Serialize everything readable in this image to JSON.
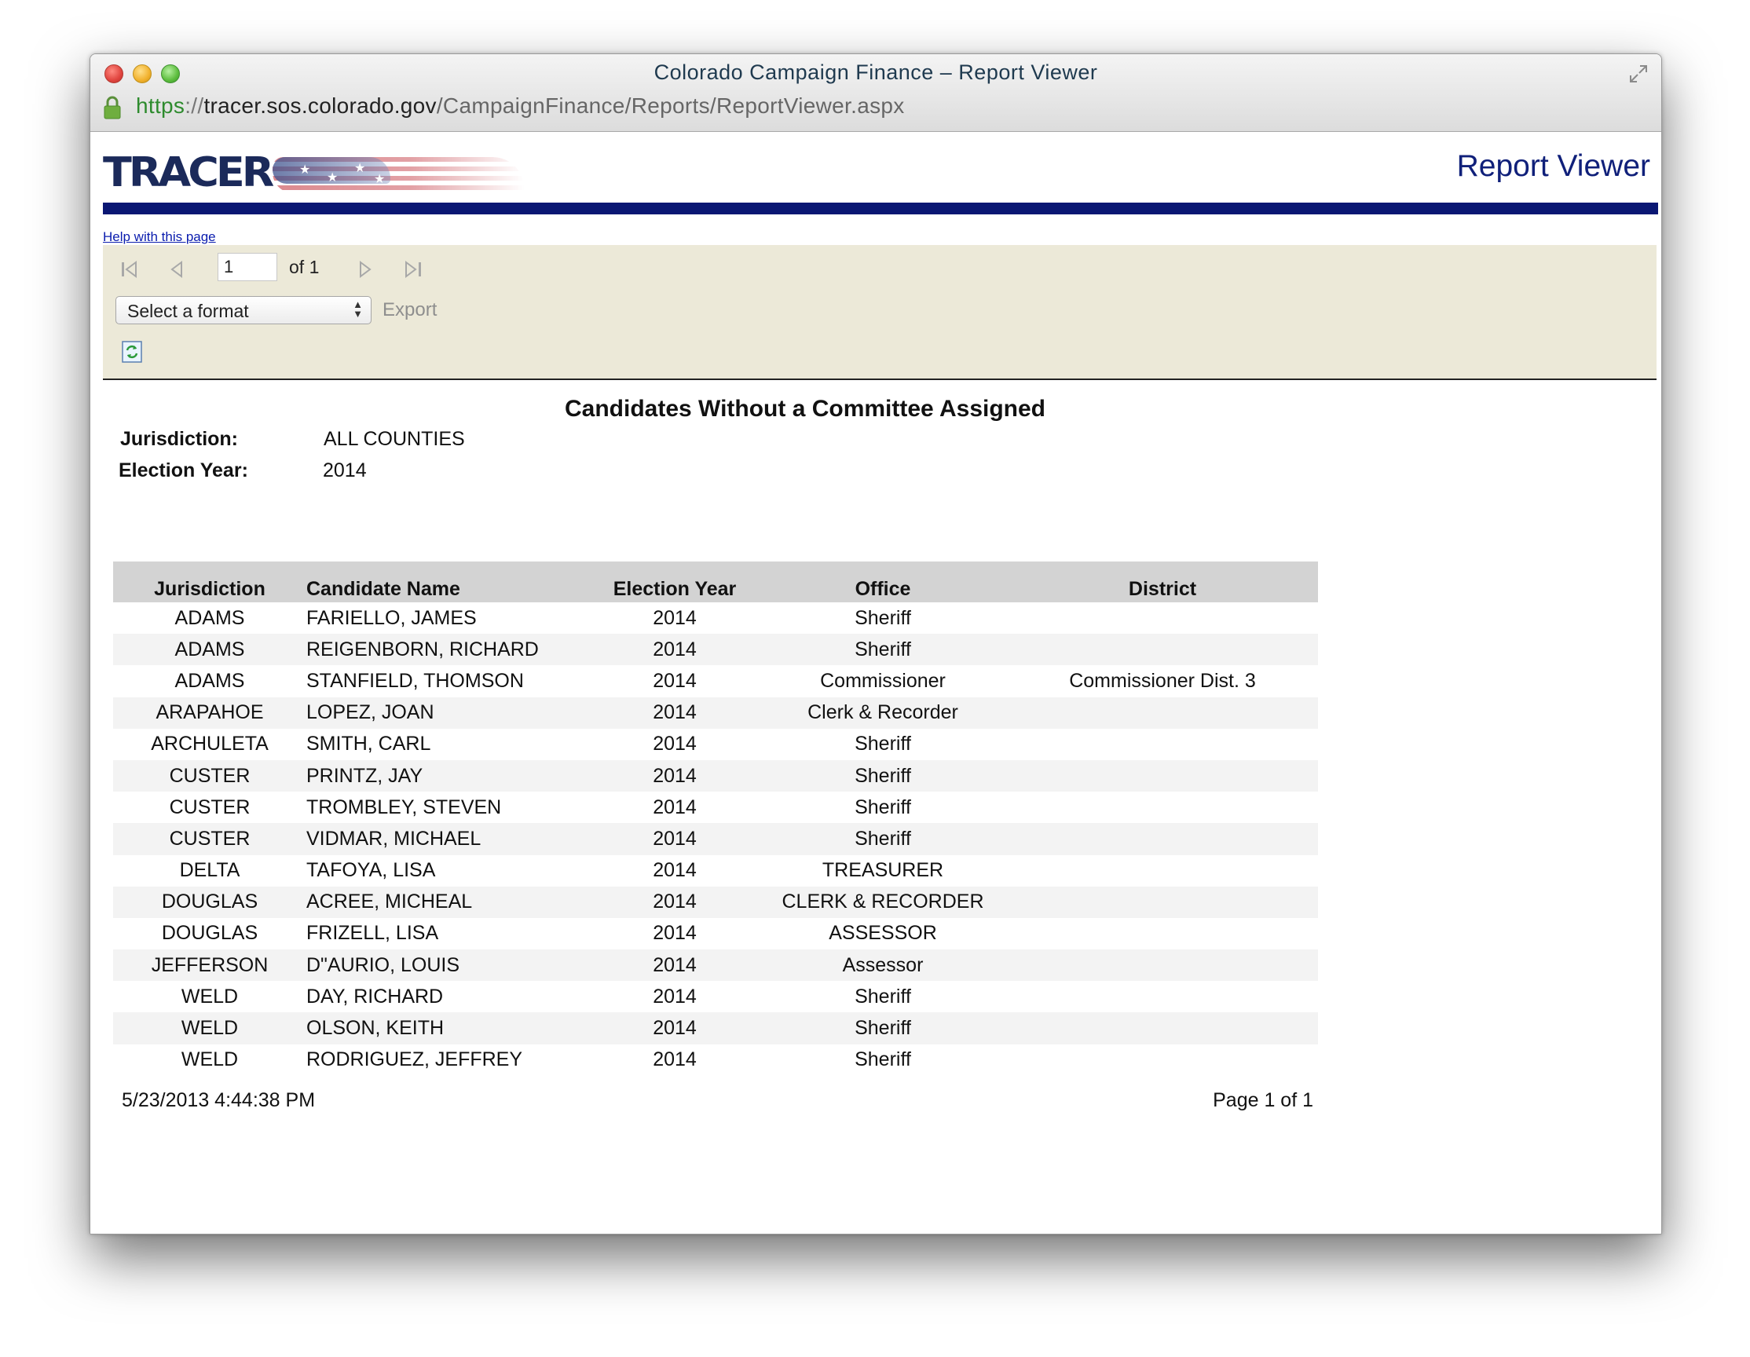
{
  "window": {
    "title": "Colorado Campaign Finance – Report Viewer",
    "url_scheme": "https",
    "url_separator": "://",
    "url_host": "tracer.sos.colorado.gov",
    "url_path": "/CampaignFinance/Reports/ReportViewer.aspx"
  },
  "header": {
    "logo_text": "TRACER",
    "page_heading": "Report Viewer",
    "help_link": "Help with this page"
  },
  "toolbar": {
    "current_page": "1",
    "page_of": "of 1",
    "format_select": "Select a format",
    "export_label": "Export"
  },
  "report": {
    "title": "Candidates Without a Committee Assigned",
    "jurisdiction_label": "Jurisdiction:",
    "jurisdiction_value": "ALL COUNTIES",
    "election_year_label": "Election Year:",
    "election_year_value": "2014",
    "columns": [
      "Jurisdiction",
      "Candidate Name",
      "Election Year",
      "Office",
      "District"
    ],
    "rows": [
      [
        "ADAMS",
        "FARIELLO, JAMES",
        "2014",
        "Sheriff",
        ""
      ],
      [
        "ADAMS",
        "REIGENBORN, RICHARD",
        "2014",
        "Sheriff",
        ""
      ],
      [
        "ADAMS",
        "STANFIELD, THOMSON",
        "2014",
        "Commissioner",
        "Commissioner Dist. 3"
      ],
      [
        "ARAPAHOE",
        "LOPEZ, JOAN",
        "2014",
        "Clerk & Recorder",
        ""
      ],
      [
        "ARCHULETA",
        "SMITH, CARL",
        "2014",
        "Sheriff",
        ""
      ],
      [
        "CUSTER",
        "PRINTZ, JAY",
        "2014",
        "Sheriff",
        ""
      ],
      [
        "CUSTER",
        "TROMBLEY, STEVEN",
        "2014",
        "Sheriff",
        ""
      ],
      [
        "CUSTER",
        "VIDMAR, MICHAEL",
        "2014",
        "Sheriff",
        ""
      ],
      [
        "DELTA",
        "TAFOYA, LISA",
        "2014",
        "TREASURER",
        ""
      ],
      [
        "DOUGLAS",
        "ACREE, MICHEAL",
        "2014",
        "CLERK & RECORDER",
        ""
      ],
      [
        "DOUGLAS",
        "FRIZELL, LISA",
        "2014",
        "ASSESSOR",
        ""
      ],
      [
        "JEFFERSON",
        "D\"AURIO, LOUIS",
        "2014",
        "Assessor",
        ""
      ],
      [
        "WELD",
        "DAY, RICHARD",
        "2014",
        "Sheriff",
        ""
      ],
      [
        "WELD",
        "OLSON, KEITH",
        "2014",
        "Sheriff",
        ""
      ],
      [
        "WELD",
        "RODRIGUEZ, JEFFREY",
        "2014",
        "Sheriff",
        ""
      ]
    ],
    "timestamp": "5/23/2013 4:44:38 PM",
    "page_indicator": "Page 1 of 1"
  },
  "colors": {
    "brand_navy": "#0a1773",
    "heading_blue": "#10207a",
    "toolbar_bg": "#ece9d8",
    "header_row_bg": "#d3d3d3"
  }
}
